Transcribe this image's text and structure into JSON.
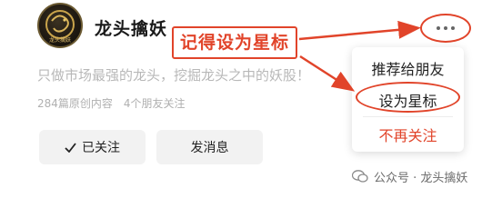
{
  "profile": {
    "avatar_text": "龙头擒妖",
    "name": "龙头擒妖",
    "bio": "只做市场最强的龙头，挖掘龙头之中的妖股！",
    "articles": "284篇原创内容",
    "friends": "4个朋友关注"
  },
  "annotation": {
    "label": "记得设为星标"
  },
  "buttons": {
    "followed": "已关注",
    "message": "发消息"
  },
  "menu": {
    "items": [
      "推荐给朋友",
      "设为星标",
      "不再关注"
    ]
  },
  "watermark": "公众号 · 龙头擒妖",
  "colors": {
    "annotation_red": "#e1442a",
    "button_bg": "#f2f2f2"
  }
}
